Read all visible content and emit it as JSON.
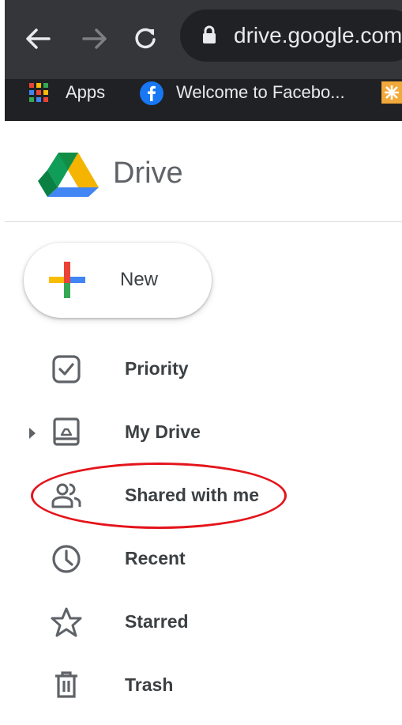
{
  "browser": {
    "url": "drive.google.com/",
    "bookmarks": [
      {
        "label": "Apps",
        "icon": "apps-grid-icon"
      },
      {
        "label": "Welcome to Facebo...",
        "icon": "facebook-icon"
      },
      {
        "label": "",
        "icon": "bookmark-favicon"
      }
    ]
  },
  "drive": {
    "title": "Drive",
    "new_label": "New",
    "nav": [
      {
        "label": "Priority",
        "icon": "priority-icon"
      },
      {
        "label": "My Drive",
        "icon": "my-drive-icon"
      },
      {
        "label": "Shared with me",
        "icon": "shared-with-me-icon"
      },
      {
        "label": "Recent",
        "icon": "recent-clock-icon"
      },
      {
        "label": "Starred",
        "icon": "star-icon"
      },
      {
        "label": "Trash",
        "icon": "trash-icon"
      }
    ]
  },
  "annotation": {
    "highlight_color": "#e4141b",
    "highlighted_item": "Shared with me"
  }
}
